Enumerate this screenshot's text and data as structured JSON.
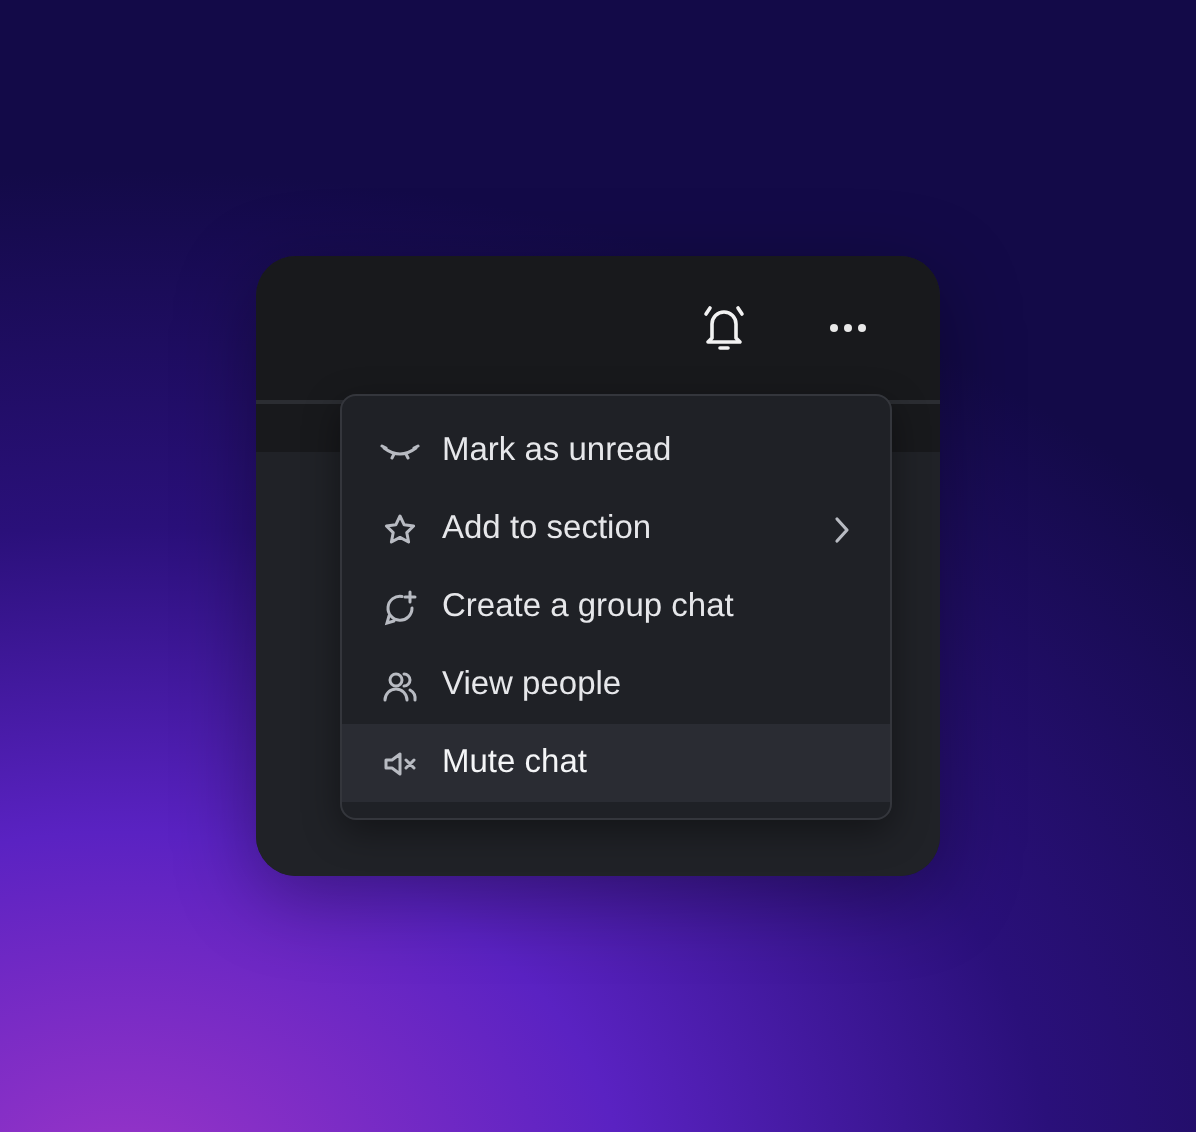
{
  "menu": {
    "items": [
      {
        "label": "Mark as unread",
        "submenu": false,
        "selected": false
      },
      {
        "label": "Add to section",
        "submenu": true,
        "selected": false
      },
      {
        "label": "Create a group chat",
        "submenu": false,
        "selected": false
      },
      {
        "label": "View people",
        "submenu": false,
        "selected": false
      },
      {
        "label": "Mute chat",
        "submenu": false,
        "selected": true
      }
    ]
  }
}
